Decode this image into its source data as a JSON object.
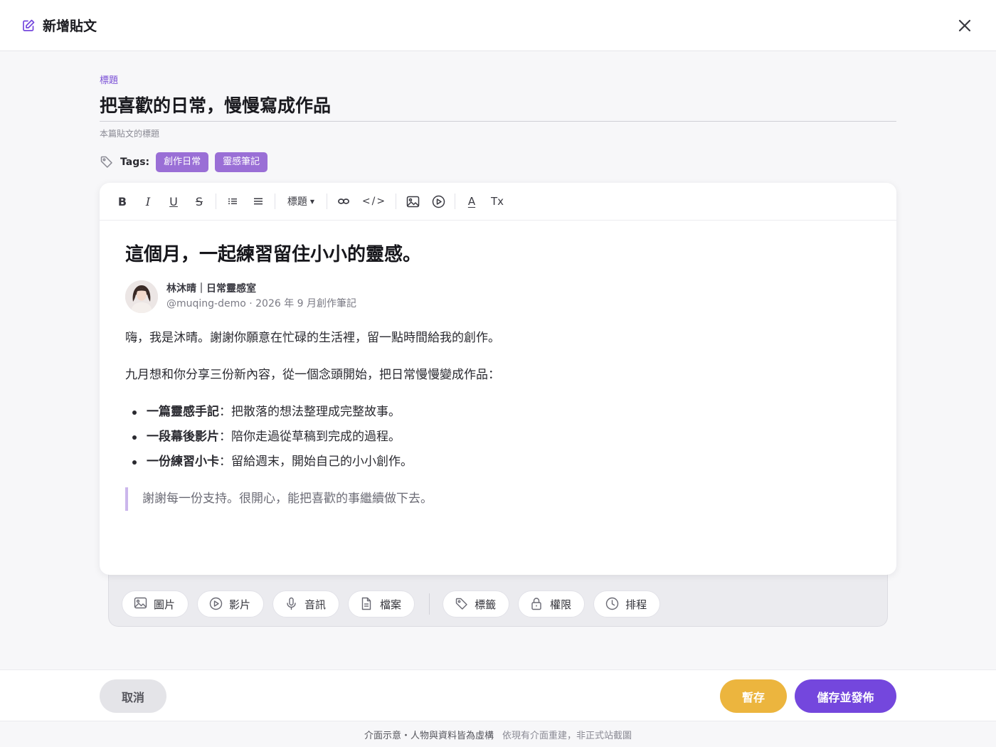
{
  "colors": {
    "accent": "#7447dd",
    "tag_bg": "#9a6fd6",
    "draft": "#ecb53e",
    "quote_bar": "#cbb6ec"
  },
  "header": {
    "title": "新增貼文",
    "icon": "edit-icon",
    "close_icon": "close-icon"
  },
  "title_field": {
    "label": "標題",
    "value": "把喜歡的日常，慢慢寫成作品",
    "hint": "本篇貼文的標題"
  },
  "tags": {
    "label": "Tags:",
    "items": [
      "創作日常",
      "靈感筆記"
    ]
  },
  "toolbar": {
    "bold": "B",
    "italic": "I",
    "underline": "U",
    "strike": "S",
    "heading": "標題",
    "code": "</>",
    "clear_format": "Tx",
    "text_color": "A"
  },
  "content": {
    "heading": "這個月，一起練習留住小小的靈感。",
    "author_name": "林沐晴｜日常靈感室",
    "author_meta": "@muqing-demo · 2026 年 9 月創作筆記",
    "para1": "嗨，我是沐晴。謝謝你願意在忙碌的生活裡，留一點時間給我的創作。",
    "para2": "九月想和你分享三份新內容，從一個念頭開始，把日常慢慢變成作品：",
    "bullets": [
      {
        "bold": "一篇靈感手記",
        "text": "：把散落的想法整理成完整故事。"
      },
      {
        "bold": "一段幕後影片",
        "text": "：陪你走過從草稿到完成的過程。"
      },
      {
        "bold": "一份練習小卡",
        "text": "：留給週末，開始自己的小小創作。"
      }
    ],
    "quote": "謝謝每一份支持。很開心，能把喜歡的事繼續做下去。"
  },
  "attachments": {
    "image": "圖片",
    "video": "影片",
    "audio": "音訊",
    "file": "檔案",
    "tag": "標籤",
    "permission": "權限",
    "schedule": "排程"
  },
  "footer": {
    "cancel": "取消",
    "draft": "暫存",
    "publish": "儲存並發佈"
  },
  "disclaimer": {
    "part1": "介面示意・人物與資料皆為虛構",
    "part2": "依現有介面重建，非正式站截圖"
  }
}
